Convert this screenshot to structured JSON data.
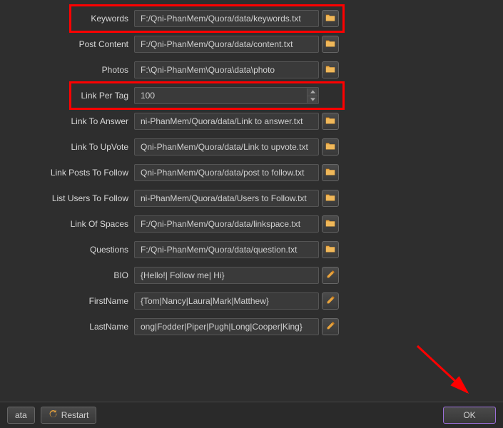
{
  "rows": [
    {
      "label": "Keywords",
      "value": "F:/Qni-PhanMem/Quora/data/keywords.txt",
      "icon": "folder"
    },
    {
      "label": "Post Content",
      "value": "F:/Qni-PhanMem/Quora/data/content.txt",
      "icon": "folder"
    },
    {
      "label": "Photos",
      "value": "F:\\Qni-PhanMem\\Quora\\data\\photo",
      "icon": "folder"
    },
    {
      "label": "Link Per Tag",
      "value": "100",
      "icon": "spinner"
    },
    {
      "label": "Link To Answer",
      "value": "ni-PhanMem/Quora/data/Link to answer.txt",
      "icon": "folder"
    },
    {
      "label": "Link To UpVote",
      "value": "Qni-PhanMem/Quora/data/Link to upvote.txt",
      "icon": "folder"
    },
    {
      "label": "Link Posts To Follow",
      "value": "Qni-PhanMem/Quora/data/post to follow.txt",
      "icon": "folder"
    },
    {
      "label": "List Users To Follow",
      "value": "ni-PhanMem/Quora/data/Users to Follow.txt",
      "icon": "folder"
    },
    {
      "label": "Link Of Spaces",
      "value": "F:/Qni-PhanMem/Quora/data/linkspace.txt",
      "icon": "folder"
    },
    {
      "label": "Questions",
      "value": "F:/Qni-PhanMem/Quora/data/question.txt",
      "icon": "folder"
    },
    {
      "label": "BIO",
      "value": "{Hello!| Follow me| Hi}",
      "icon": "pencil"
    },
    {
      "label": "FirstName",
      "value": "{Tom|Nancy|Laura|Mark|Matthew}",
      "icon": "pencil"
    },
    {
      "label": "LastName",
      "value": "ong|Fodder|Piper|Pugh|Long|Cooper|King}",
      "icon": "pencil"
    }
  ],
  "buttons": {
    "data": "ata",
    "restart": "Restart",
    "ok": "OK"
  }
}
